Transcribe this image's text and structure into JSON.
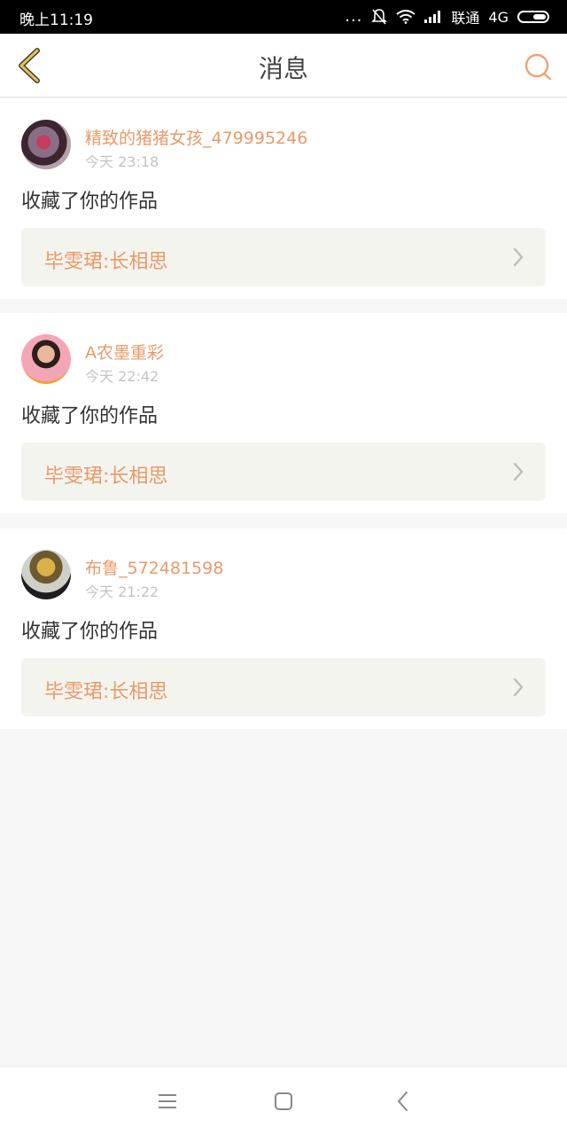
{
  "status_bar": {
    "time": "晚上11:19",
    "dots": "...",
    "carrier": "联通",
    "network": "4G"
  },
  "header": {
    "title": "消息"
  },
  "colors": {
    "accent": "#e89a6a",
    "back_arrow": "#e7c24a",
    "card_link_bg": "#f4f4ee"
  },
  "messages": [
    {
      "username": "精致的猪猪女孩_479995246",
      "time": "今天 23:18",
      "action": "收藏了你的作品",
      "work_title": "毕雯珺:长相思"
    },
    {
      "username": "A农墨重彩",
      "time": "今天 22:42",
      "action": "收藏了你的作品",
      "work_title": "毕雯珺:长相思"
    },
    {
      "username": "布鲁_572481598",
      "time": "今天 21:22",
      "action": "收藏了你的作品",
      "work_title": "毕雯珺:长相思"
    }
  ],
  "icons": {
    "back": "chevron-left-icon",
    "search": "search-icon",
    "menu": "menu-icon",
    "home": "home-icon",
    "nav_back": "back-icon"
  }
}
